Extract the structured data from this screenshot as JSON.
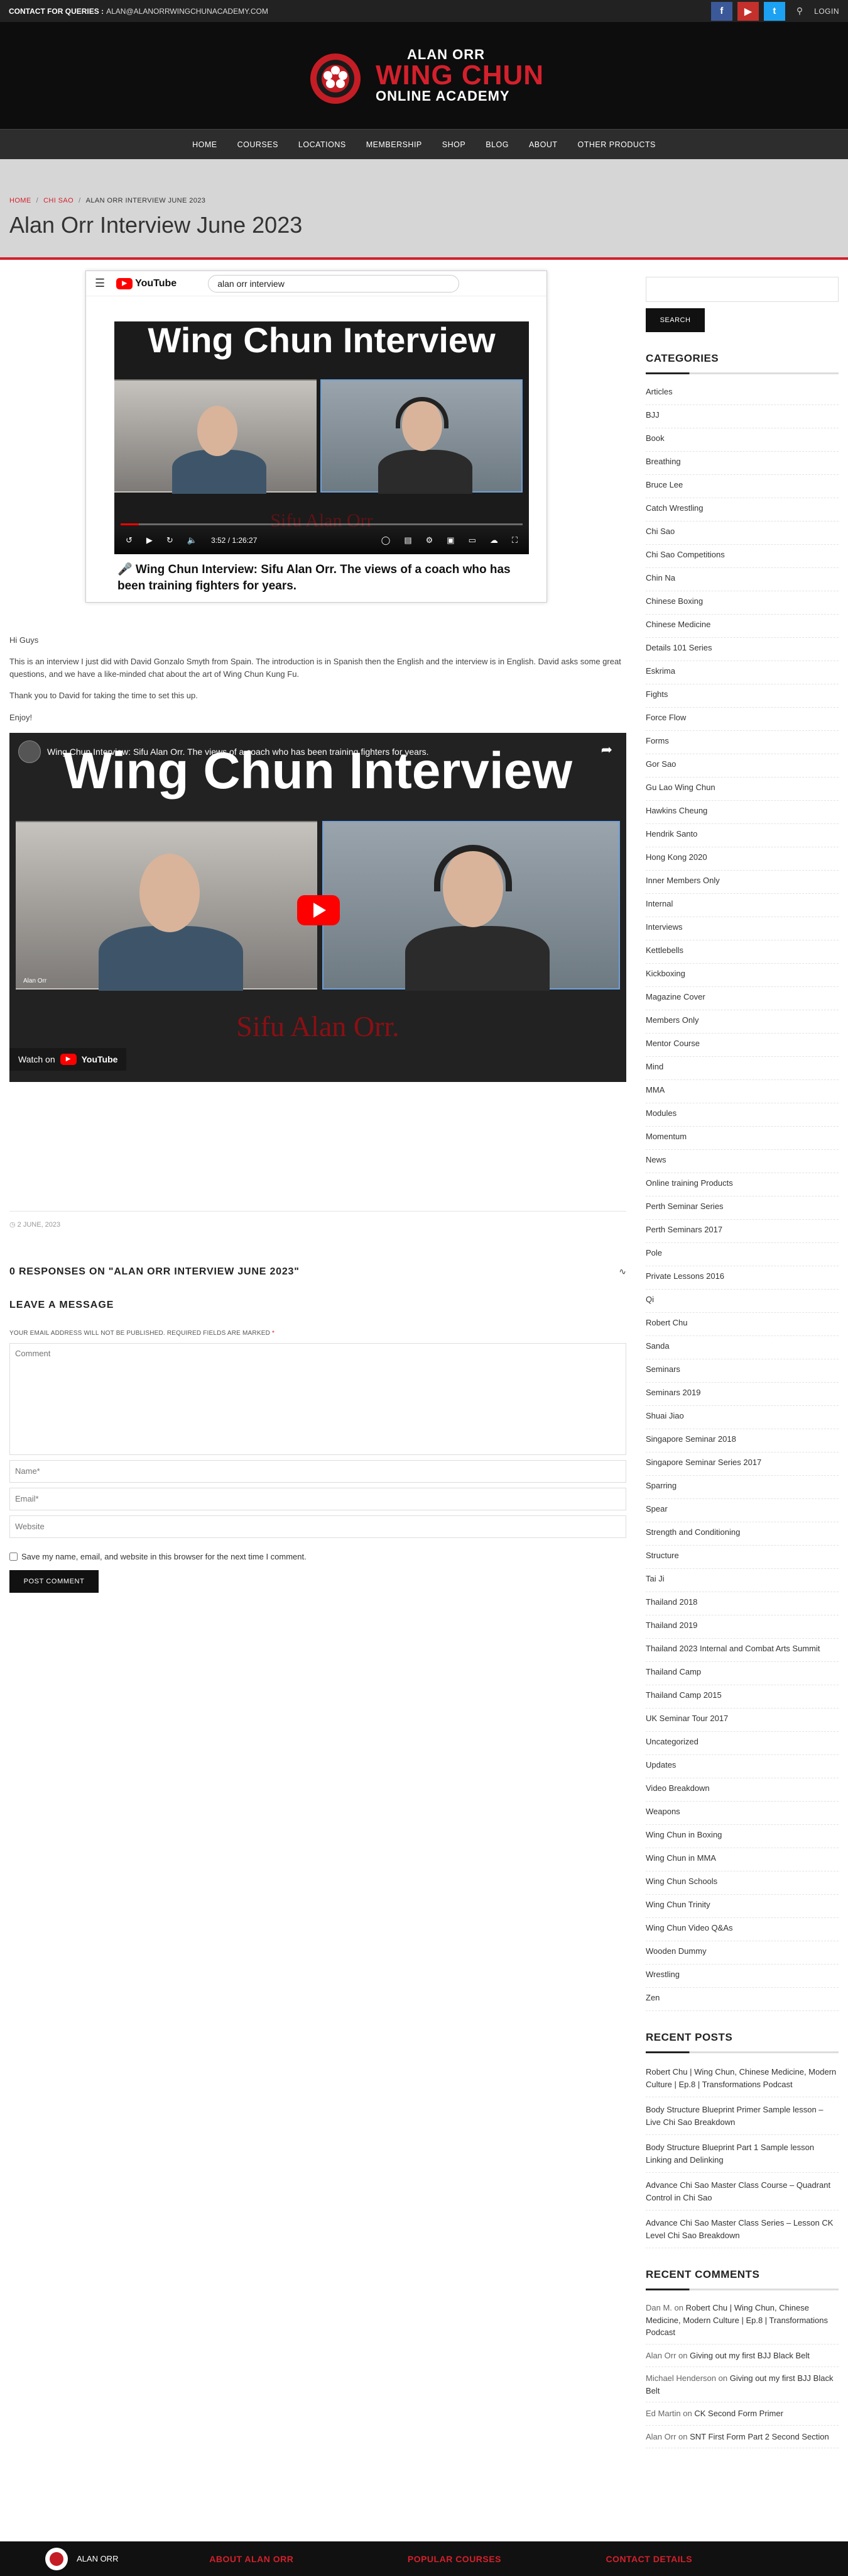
{
  "topbar": {
    "label": "CONTACT FOR QUERIES :",
    "email": "ALAN@ALANORRWINGCHUNACADEMY.COM",
    "login": "LOGIN"
  },
  "logo": {
    "line1": "ALAN ORR",
    "line2": "WING CHUN",
    "line3": "ONLINE ACADEMY"
  },
  "nav": [
    "HOME",
    "COURSES",
    "LOCATIONS",
    "MEMBERSHIP",
    "SHOP",
    "BLOG",
    "ABOUT",
    "OTHER PRODUCTS"
  ],
  "breadcrumb": {
    "home": "HOME",
    "cat": "CHI SAO",
    "current": "ALAN ORR INTERVIEW JUNE 2023"
  },
  "page_title": "Alan Orr Interview June 2023",
  "embed1": {
    "search_value": "alan orr interview",
    "video_title": "Wing Chun Interview",
    "signature": "Sifu Alan Orr",
    "time": "3:52 / 1:26:27",
    "progress_fraction": 0.045,
    "caption": "🎤 Wing Chun Interview: Sifu Alan Orr. The views of a coach who has been training fighters for years."
  },
  "post": {
    "p1": "Hi Guys",
    "p2": "This is an interview I just did with David Gonzalo Smyth from Spain. The introduction is in Spanish then the English and the interview is in English. David asks some great questions, and we have a like-minded chat about the art of Wing Chun Kung Fu.",
    "p3": "Thank you to David for taking the time to set this up.",
    "p4": "Enjoy!"
  },
  "embed2": {
    "channel_title": "Wing Chun Interview: Sifu Alan Orr. The views of a coach who has been training fighters for years.",
    "video_title": "Wing Chun Interview",
    "signature": "Sifu Alan Orr.",
    "name_tag": "Alan Orr",
    "watch_on": "Watch on",
    "youtube": "YouTube"
  },
  "meta_date": "2 JUNE, 2023",
  "responses_title": "0 RESPONSES ON \"ALAN ORR INTERVIEW JUNE 2023\"",
  "leave_title": "LEAVE A MESSAGE",
  "form": {
    "note": "YOUR EMAIL ADDRESS WILL NOT BE PUBLISHED. REQUIRED FIELDS ARE MARKED",
    "req": "*",
    "comment_ph": "Comment",
    "name_ph": "Name*",
    "email_ph": "Email*",
    "website_ph": "Website",
    "save_label": "Save my name, email, and website in this browser for the next time I comment.",
    "submit": "POST COMMENT"
  },
  "sidebar": {
    "search_btn": "SEARCH",
    "categories_title": "CATEGORIES",
    "categories": [
      "Articles",
      "BJJ",
      "Book",
      "Breathing",
      "Bruce Lee",
      "Catch Wrestling",
      "Chi Sao",
      "Chi Sao Competitions",
      "Chin Na",
      "Chinese Boxing",
      "Chinese Medicine",
      "Details 101 Series",
      "Eskrima",
      "Fights",
      "Force Flow",
      "Forms",
      "Gor Sao",
      "Gu Lao Wing Chun",
      "Hawkins Cheung",
      "Hendrik Santo",
      "Hong Kong 2020",
      "Inner Members Only",
      "Internal",
      "Interviews",
      "Kettlebells",
      "Kickboxing",
      "Magazine Cover",
      "Members Only",
      "Mentor Course",
      "Mind",
      "MMA",
      "Modules",
      "Momentum",
      "News",
      "Online training Products",
      "Perth Seminar Series",
      "Perth Seminars 2017",
      "Pole",
      "Private Lessons 2016",
      "Qi",
      "Robert Chu",
      "Sanda",
      "Seminars",
      "Seminars 2019",
      "Shuai Jiao",
      "Singapore Seminar 2018",
      "Singapore Seminar Series 2017",
      "Sparring",
      "Spear",
      "Strength and Conditioning",
      "Structure",
      "Tai Ji",
      "Thailand 2018",
      "Thailand 2019",
      "Thailand 2023 Internal and Combat Arts Summit",
      "Thailand Camp",
      "Thailand Camp 2015",
      "UK Seminar Tour 2017",
      "Uncategorized",
      "Updates",
      "Video Breakdown",
      "Weapons",
      "Wing Chun in Boxing",
      "Wing Chun in MMA",
      "Wing Chun Schools",
      "Wing Chun Trinity",
      "Wing Chun Video Q&As",
      "Wooden Dummy",
      "Wrestling",
      "Zen"
    ],
    "recent_posts_title": "RECENT POSTS",
    "recent_posts": [
      "Robert Chu | Wing Chun, Chinese Medicine, Modern Culture | Ep.8 | Transformations Podcast",
      "Body Structure Blueprint Primer Sample lesson – Live Chi Sao Breakdown",
      "Body Structure Blueprint Part 1 Sample lesson Linking and Delinking",
      "Advance Chi Sao Master Class Course – Quadrant Control in Chi Sao",
      "Advance Chi Sao Master Class Series – Lesson CK Level Chi Sao Breakdown"
    ],
    "recent_comments_title": "RECENT COMMENTS",
    "recent_comments": [
      {
        "author": "Dan M.",
        "on": "on",
        "post": "Robert Chu | Wing Chun, Chinese Medicine, Modern Culture | Ep.8 | Transformations Podcast"
      },
      {
        "author": "Alan Orr",
        "on": "on",
        "post": "Giving out my first BJJ Black Belt"
      },
      {
        "author": "Michael Henderson",
        "on": "on",
        "post": "Giving out my first BJJ Black Belt"
      },
      {
        "author": "Ed Martin",
        "on": "on",
        "post": "CK Second Form Primer"
      },
      {
        "author": "Alan Orr",
        "on": "on",
        "post": "SNT First Form Part 2 Second Section"
      }
    ]
  },
  "footer": {
    "logo_text": "ALAN ORR",
    "about": "ABOUT ALAN ORR",
    "popular": "POPULAR COURSES",
    "contact": "CONTACT DETAILS"
  }
}
